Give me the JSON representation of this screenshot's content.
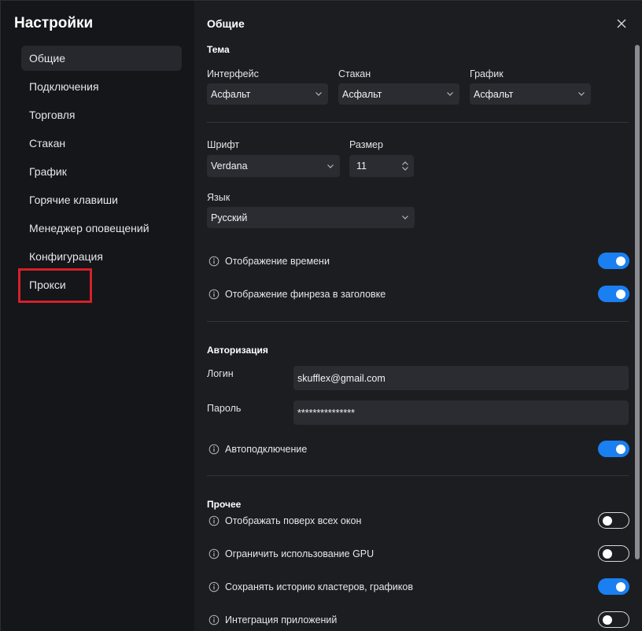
{
  "sidebar": {
    "title": "Настройки",
    "items": [
      {
        "label": "Общие",
        "active": true
      },
      {
        "label": "Подключения"
      },
      {
        "label": "Торговля"
      },
      {
        "label": "Стакан"
      },
      {
        "label": "График"
      },
      {
        "label": "Горячие клавиши"
      },
      {
        "label": "Менеджер оповещений"
      },
      {
        "label": "Конфигурация"
      },
      {
        "label": "Прокси",
        "highlighted": true
      }
    ]
  },
  "main": {
    "title": "Общие",
    "theme": {
      "section": "Тема",
      "interface_label": "Интерфейс",
      "interface_value": "Асфальт",
      "orderbook_label": "Стакан",
      "orderbook_value": "Асфальт",
      "chart_label": "График",
      "chart_value": "Асфальт"
    },
    "font": {
      "font_label": "Шрифт",
      "font_value": "Verdana",
      "size_label": "Размер",
      "size_value": "11",
      "language_label": "Язык",
      "language_value": "Русский"
    },
    "display": {
      "time_label": "Отображение времени",
      "time_on": true,
      "finrez_label": "Отображение финреза в заголовке",
      "finrez_on": true
    },
    "auth": {
      "section": "Авторизация",
      "login_label": "Логин",
      "login_value": "skufflex@gmail.com",
      "password_label": "Пароль",
      "password_value": "***************",
      "autoconnect_label": "Автоподключение",
      "autoconnect_on": true
    },
    "other": {
      "section": "Прочее",
      "on_top_label": "Отображать поверх всех окон",
      "on_top_on": false,
      "gpu_label": "Ограничить использование GPU",
      "gpu_on": false,
      "history_label": "Сохранять историю кластеров, графиков",
      "history_on": true,
      "integration_label": "Интеграция приложений",
      "integration_on": false
    }
  },
  "colors": {
    "accent": "#1a7ff0",
    "highlight": "#d4202a",
    "sidebar_bg": "#151619",
    "main_bg": "#1c1d21",
    "input_bg": "#2a2c31"
  }
}
